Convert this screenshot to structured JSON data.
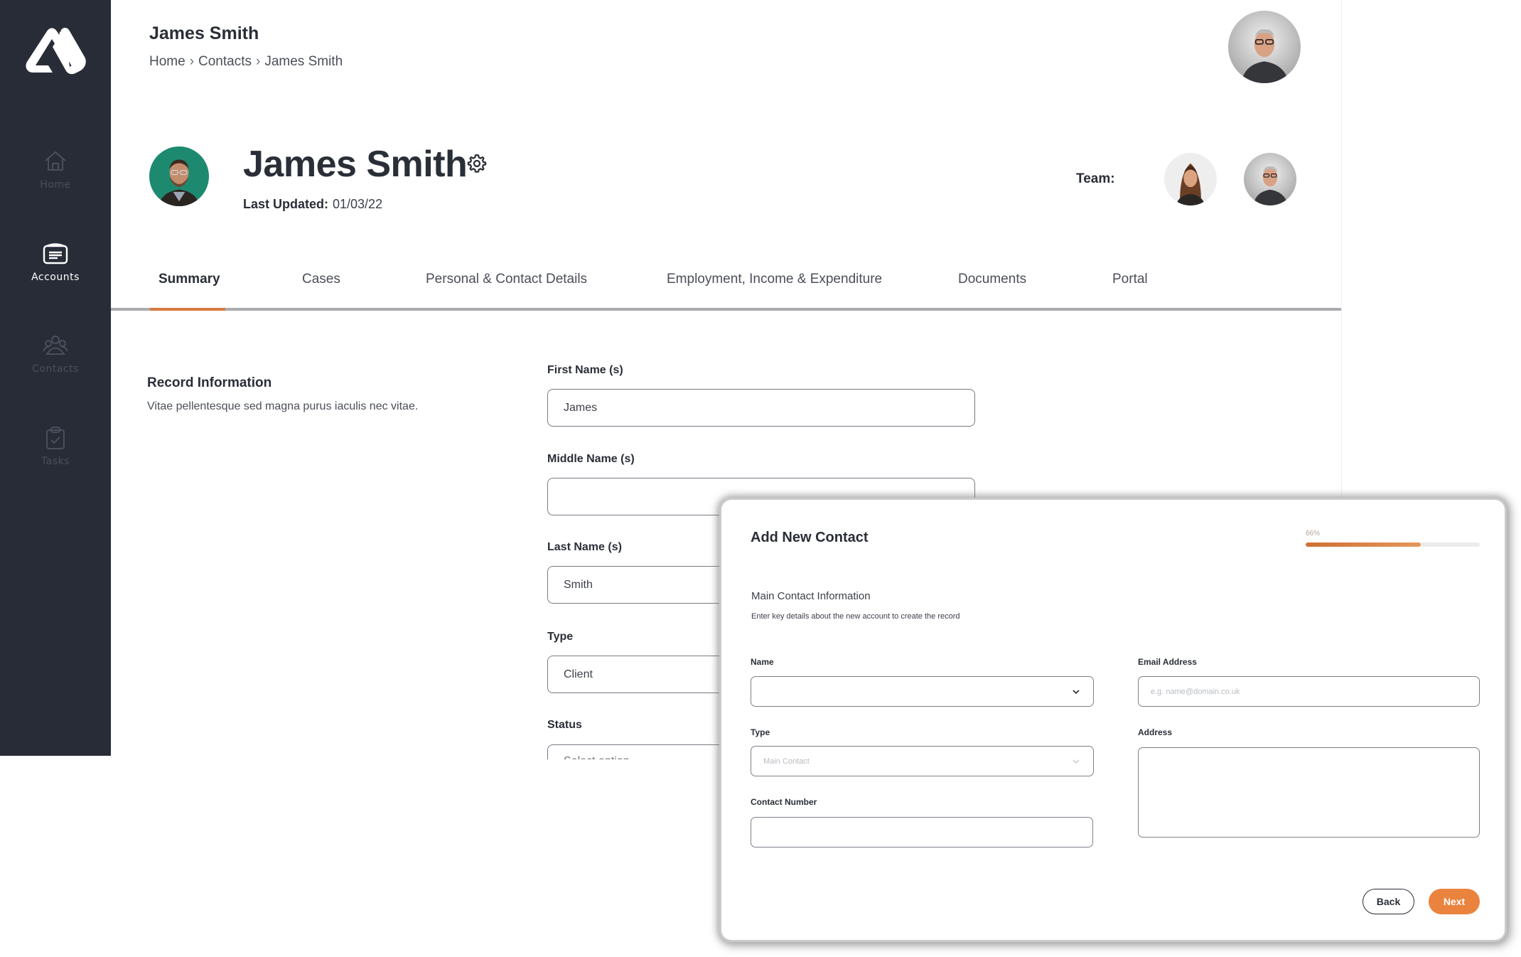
{
  "sidebar": {
    "logo": "app-logo",
    "items": [
      {
        "label": "Home",
        "icon": "home-icon",
        "active": false
      },
      {
        "label": "Accounts",
        "icon": "accounts-card-icon",
        "active": true
      },
      {
        "label": "Contacts",
        "icon": "contacts-group-icon",
        "active": false
      },
      {
        "label": "Tasks",
        "icon": "tasks-clipboard-icon",
        "active": false
      }
    ]
  },
  "header": {
    "title": "James Smith",
    "breadcrumb": [
      "Home",
      "Contacts",
      "James Smith"
    ],
    "breadcrumb_separator": "›"
  },
  "profile": {
    "name": "James Smith",
    "last_updated_label": "Last Updated:",
    "last_updated_value": "01/03/22",
    "team_label": "Team:"
  },
  "tabs": [
    {
      "label": "Summary",
      "active": true
    },
    {
      "label": "Cases",
      "active": false
    },
    {
      "label": "Personal & Contact Details",
      "active": false
    },
    {
      "label": "Employment, Income & Expenditure",
      "active": false
    },
    {
      "label": "Documents",
      "active": false
    },
    {
      "label": "Portal",
      "active": false
    }
  ],
  "record": {
    "title": "Record Information",
    "description": "Vitae pellentesque sed magna purus iaculis nec vitae.",
    "fields": [
      {
        "label": "First Name (s)",
        "value": "James"
      },
      {
        "label": "Middle Name (s)",
        "value": ""
      },
      {
        "label": "Last Name (s)",
        "value": "Smith"
      },
      {
        "label": "Type",
        "value": "Client"
      },
      {
        "label": "Status",
        "value": "Select option"
      }
    ]
  },
  "modal": {
    "title": "Add New Contact",
    "progress_label": "66%",
    "progress_fraction": 0.66,
    "section_title": "Main Contact Information",
    "section_desc": "Enter key details about the new account to create the record",
    "fields": {
      "name": {
        "label": "Name",
        "value": ""
      },
      "type": {
        "label": "Type",
        "placeholder": "Main Contact"
      },
      "contact_number": {
        "label": "Contact Number",
        "value": ""
      },
      "email": {
        "label": "Email Address",
        "placeholder": "e.g. name@domain.co.uk"
      },
      "address": {
        "label": "Address",
        "value": ""
      }
    },
    "back_label": "Back",
    "next_label": "Next"
  },
  "colors": {
    "sidebar_bg": "#282c37",
    "accent": "#ea833d",
    "tab_underline": "#d8793e",
    "text_primary": "#2a2e37"
  }
}
